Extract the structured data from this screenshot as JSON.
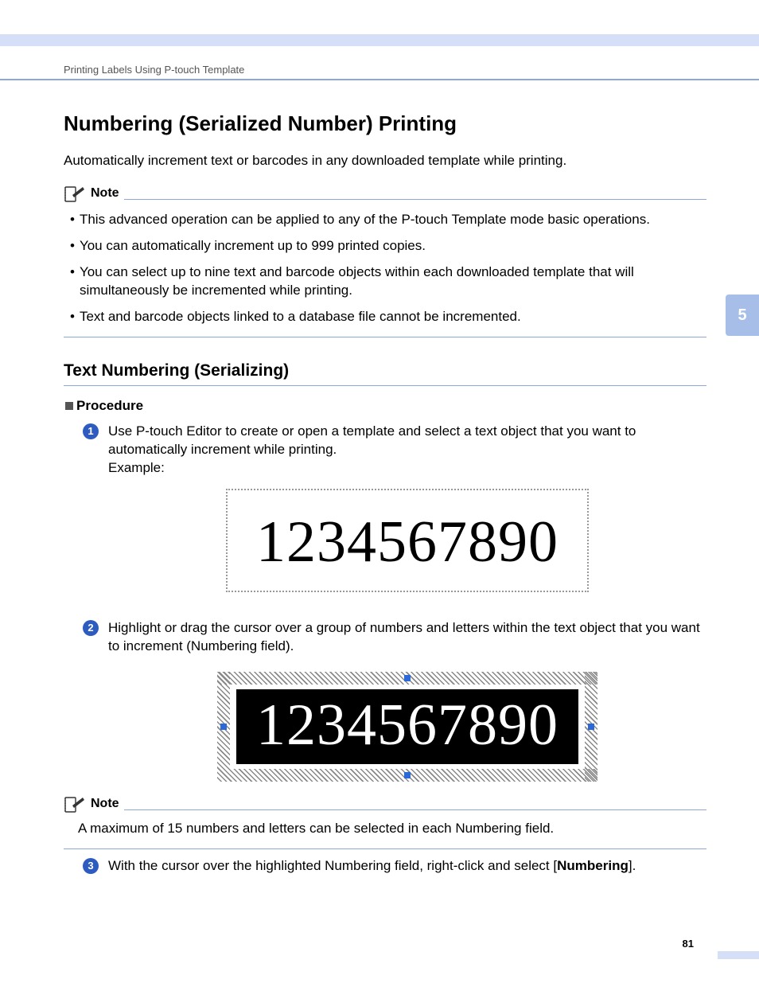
{
  "crumb": "Printing Labels Using P-touch Template",
  "h1": "Numbering (Serialized Number) Printing",
  "intro": "Automatically increment text or barcodes in any downloaded template while printing.",
  "note_label": "Note",
  "notes1": [
    "This advanced operation can be applied to any of the P-touch Template mode basic operations.",
    "You can automatically increment up to 999 printed copies.",
    "You can select up to nine text and barcode objects within each downloaded template that will simultaneously be incremented while printing.",
    "Text and barcode objects linked to a database file cannot be incremented."
  ],
  "h2": "Text Numbering (Serializing)",
  "procedure_label": "Procedure",
  "steps": {
    "s1": {
      "num": "1",
      "text": "Use P-touch Editor to create or open a template and select a text object that you want to automatically increment while printing.",
      "example_label": "Example:"
    },
    "s2": {
      "num": "2",
      "text": "Highlight or drag the cursor over a group of numbers and letters within the text object that you want to increment (Numbering field)."
    },
    "s3": {
      "num": "3",
      "pre": "With the cursor over the highlighted Numbering field, right-click and select [",
      "bold": "Numbering",
      "post": "]."
    }
  },
  "example_value": "1234567890",
  "selected_value": "1234567890",
  "note2_body": "A maximum of 15 numbers and letters can be selected in each Numbering field.",
  "side_tab": "5",
  "page_number": "81"
}
